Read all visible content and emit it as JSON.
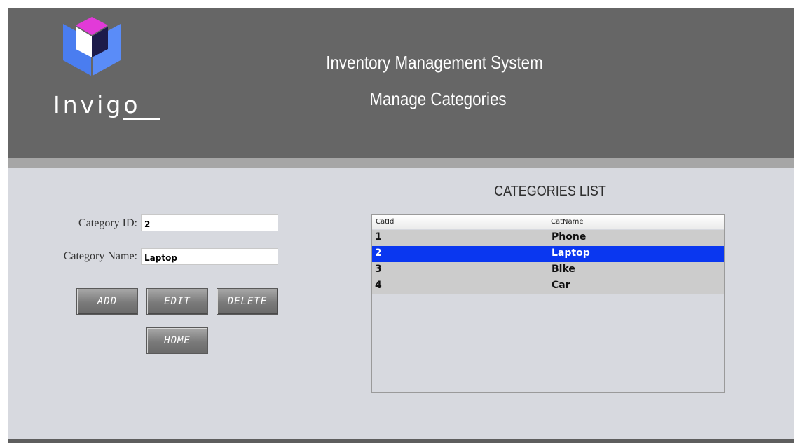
{
  "logo": {
    "text": "Invigo"
  },
  "header": {
    "app_title": "Inventory Management System",
    "page_title": "Manage Categories"
  },
  "form": {
    "category_id_label": "Category ID:",
    "category_id_value": "2",
    "category_name_label": "Category Name:",
    "category_name_value": "Laptop"
  },
  "buttons": {
    "add": "ADD",
    "edit": "EDIT",
    "delete": "DELETE",
    "home": "HOME"
  },
  "categories": {
    "title": "CATEGORIES LIST",
    "columns": [
      "CatId",
      "CatName"
    ],
    "rows": [
      {
        "id": "1",
        "name": "Phone"
      },
      {
        "id": "2",
        "name": "Laptop"
      },
      {
        "id": "3",
        "name": "Bike"
      },
      {
        "id": "4",
        "name": "Car"
      }
    ],
    "selected_id": "2"
  },
  "colors": {
    "header_bg": "#666666",
    "body_bg": "#d7d9df",
    "selected_row": "#0a37f0",
    "logo_blue": "#4a7df0",
    "logo_magenta": "#e23ad8",
    "logo_navy": "#1d1b4a"
  }
}
